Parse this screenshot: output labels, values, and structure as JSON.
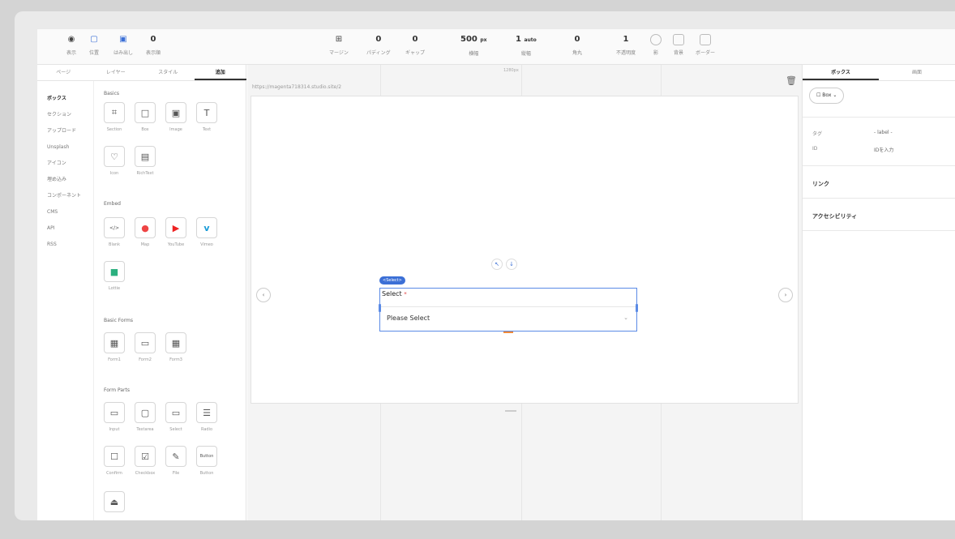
{
  "toolbar": {
    "items": [
      {
        "label": "表示"
      },
      {
        "label": "位置"
      },
      {
        "label": "はみ出し"
      },
      {
        "label": "表示順"
      },
      {
        "label": "マージン"
      },
      {
        "label": "パディング"
      },
      {
        "label": "ギャップ"
      },
      {
        "label": "横幅"
      },
      {
        "label": "縦幅"
      },
      {
        "label": "角丸"
      },
      {
        "label": "不透明度"
      },
      {
        "label": "影"
      },
      {
        "label": "背景"
      },
      {
        "label": "ボーダー"
      }
    ],
    "values": {
      "order": "0",
      "padding": "0",
      "gap": "0",
      "width": "500",
      "width_unit": "px",
      "height": "1",
      "height_unit": "auto",
      "radius": "0",
      "opacity": "1"
    }
  },
  "left_panel": {
    "tabs": [
      "ページ",
      "レイヤー",
      "スタイル",
      "追加"
    ],
    "categories": [
      "ボックス",
      "セクション",
      "アップロード",
      "Unsplash",
      "アイコン",
      "埋め込み",
      "コンポーネント",
      "CMS",
      "API",
      "RSS"
    ],
    "sections": {
      "basics": "Basics",
      "embed": "Embed",
      "basic_forms": "Basic Forms",
      "form_parts": "Form Parts"
    },
    "basics_items": [
      "Section",
      "Box",
      "Image",
      "Text",
      "Icon",
      "RichText"
    ],
    "embed_items": [
      "Blank",
      "Map",
      "YouTube",
      "Vimeo",
      "Lottie"
    ],
    "basic_form_items": [
      "Form1",
      "Form2",
      "Form3"
    ],
    "form_part_items": [
      "Input",
      "Textarea",
      "Select",
      "Radio",
      "Confirm",
      "Checkbox",
      "File",
      "Button"
    ],
    "icon_text": {
      "text_glyph": "T",
      "blank_glyph": "</>",
      "button_glyph": "Button"
    }
  },
  "canvas": {
    "url": "https://magenta718314.studio.site/2",
    "breakpoint": "1280px",
    "element_tag": "<Select>",
    "select_label": "Select",
    "required_mark": "*",
    "placeholder": "Please Select"
  },
  "right_panel": {
    "tabs": [
      "ボックス",
      "画面"
    ],
    "chip": "Box",
    "props": [
      {
        "name": "タグ",
        "value": "- label -"
      },
      {
        "name": "ID",
        "value": "IDを入力"
      }
    ],
    "sections": [
      "リンク",
      "アクセシビリティ"
    ]
  },
  "colors": {
    "accent": "#3b6fd6",
    "handle": "#f08a3a",
    "required": "#e04040"
  }
}
